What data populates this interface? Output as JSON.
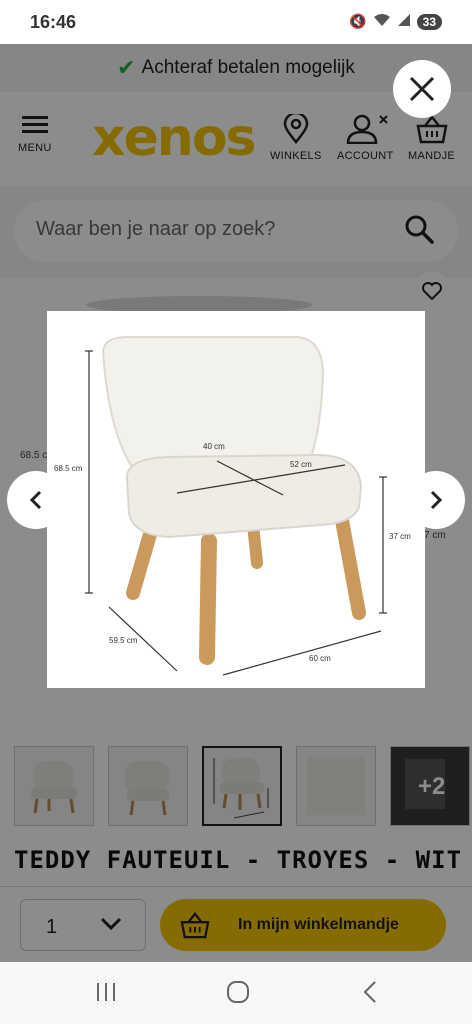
{
  "status_bar": {
    "time": "16:46",
    "battery": "33"
  },
  "promo": {
    "text": "Achteraf betalen mogelijk"
  },
  "header": {
    "menu_label": "MENU",
    "logo": "xenos",
    "stores_label": "WINKELS",
    "account_label": "ACCOUNT",
    "cart_label": "MANDJE"
  },
  "search": {
    "placeholder": "Waar ben je naar op zoek?"
  },
  "gallery": {
    "behind_dim_left": "68.5 c",
    "behind_dim_right": "7 cm",
    "more_count": "+2",
    "dimensions": {
      "height": "68.5 cm",
      "seat_depth": "40 cm",
      "seat_width": "52 cm",
      "seat_height": "37 cm",
      "depth": "59.5 cm",
      "width": "60 cm"
    }
  },
  "product": {
    "title": "TEDDY FAUTEUIL - TROYES - WIT"
  },
  "cart": {
    "quantity": "1",
    "add_label": "In mijn winkelmandje"
  },
  "colors": {
    "brand_yellow": "#f4c500",
    "check_green": "#2bab3c"
  }
}
